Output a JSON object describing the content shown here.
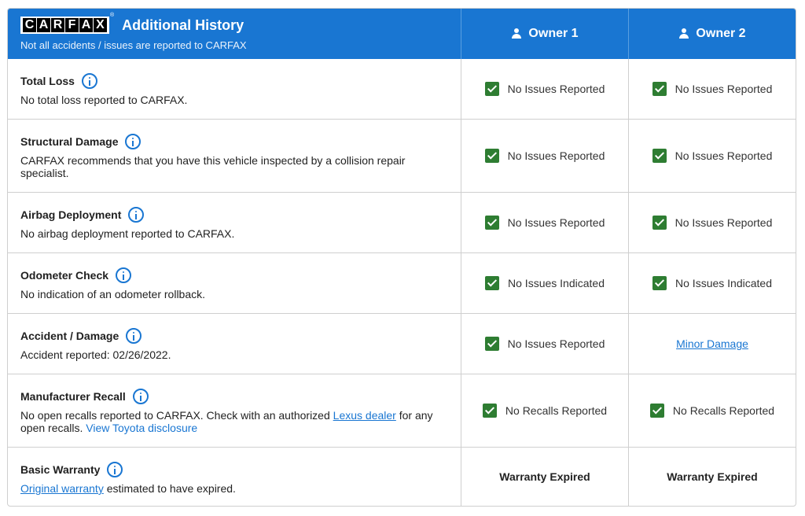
{
  "header": {
    "logo_letters": [
      "C",
      "A",
      "R",
      "F",
      "A",
      "X"
    ],
    "logo_registered": "®",
    "title": "Additional History",
    "subtitle": "Not all accidents / issues are reported to CARFAX",
    "owners": [
      "Owner 1",
      "Owner 2"
    ]
  },
  "rows": [
    {
      "label": "Total Loss",
      "description": "No total loss reported to CARFAX.",
      "owner1": "No Issues Reported",
      "owner2": "No Issues Reported"
    },
    {
      "label": "Structural Damage",
      "description": "CARFAX recommends that you have this vehicle inspected by a collision repair specialist.",
      "owner1": "No Issues Reported",
      "owner2": "No Issues Reported"
    },
    {
      "label": "Airbag Deployment",
      "description": "No airbag deployment reported to CARFAX.",
      "owner1": "No Issues Reported",
      "owner2": "No Issues Reported"
    },
    {
      "label": "Odometer Check",
      "description": "No indication of an odometer rollback.",
      "owner1": "No Issues Indicated",
      "owner2": "No Issues Indicated"
    },
    {
      "label": "Accident / Damage",
      "description": "Accident reported: 02/26/2022.",
      "owner1": "No Issues Reported",
      "owner2": "Minor Damage"
    },
    {
      "label": "Manufacturer Recall",
      "description_pre": "No open recalls reported to CARFAX. Check with an authorized ",
      "dealer_link": "Lexus dealer",
      "description_mid": " for any open recalls. ",
      "disclosure_link": "View Toyota disclosure",
      "owner1": "No Recalls Reported",
      "owner2": "No Recalls Reported"
    },
    {
      "label": "Basic Warranty",
      "warranty_link": "Original warranty",
      "description_post": " estimated to have expired.",
      "owner1": "Warranty Expired",
      "owner2": "Warranty Expired"
    }
  ],
  "colors": {
    "header_bg": "#1976d2",
    "check_green": "#2e7d32",
    "link_blue": "#1976d2"
  }
}
